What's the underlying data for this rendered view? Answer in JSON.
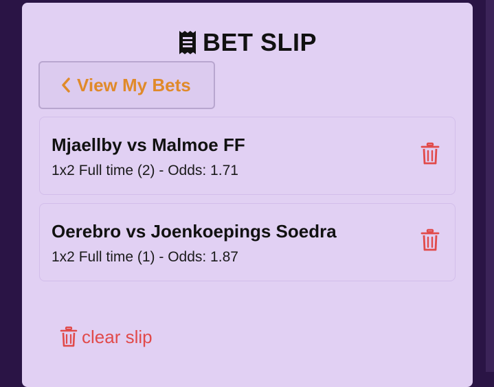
{
  "header": {
    "title": "BET SLIP",
    "icon": "receipt-icon"
  },
  "nav": {
    "view_bets_label": "View My Bets",
    "icon": "chevron-left-icon"
  },
  "bets": [
    {
      "match": "Mjaellby vs Malmoe FF",
      "detail": "1x2 Full time (2) - Odds: 1.71",
      "icon": "trash-icon"
    },
    {
      "match": "Oerebro vs Joenkoepings Soedra",
      "detail": "1x2 Full time (1) - Odds: 1.87",
      "icon": "trash-icon"
    }
  ],
  "footer": {
    "clear_label": "clear slip",
    "icon": "trash-icon"
  },
  "colors": {
    "background": "#2a1445",
    "panel": "#e1d0f3",
    "accent_orange": "#e08a2a",
    "danger_red": "#e14a4a",
    "text": "#111111"
  }
}
